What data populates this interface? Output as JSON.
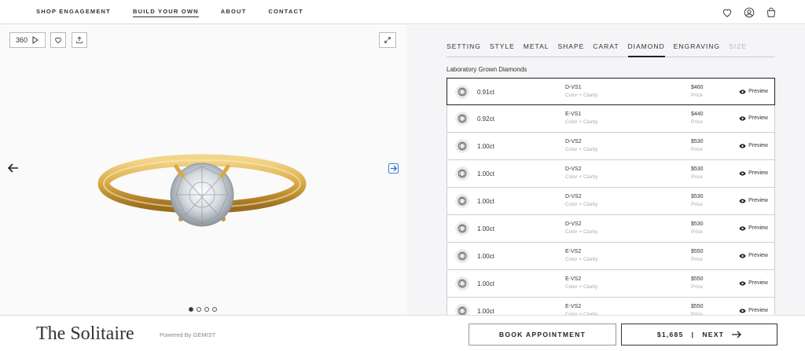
{
  "nav": {
    "links": [
      {
        "label": "SHOP ENGAGEMENT"
      },
      {
        "label": "BUILD YOUR OWN"
      },
      {
        "label": "ABOUT"
      },
      {
        "label": "CONTACT"
      }
    ],
    "active_index": 1,
    "icons": [
      "heart-icon",
      "account-icon",
      "bag-icon"
    ]
  },
  "viewer": {
    "btn_360_label": "360",
    "image_count": 4,
    "active_image": 1
  },
  "tabs": [
    {
      "label": "SETTING"
    },
    {
      "label": "STYLE"
    },
    {
      "label": "METAL"
    },
    {
      "label": "SHAPE"
    },
    {
      "label": "CARAT"
    },
    {
      "label": "DIAMOND"
    },
    {
      "label": "ENGRAVING"
    },
    {
      "label": "SIZE"
    }
  ],
  "active_tab": 5,
  "disabled_tab": 7,
  "section_title": "Laboratory Grown Diamonds",
  "grade_sublabel": "Color + Clarity",
  "price_sublabel": "Price",
  "preview_label": "Preview",
  "diamonds": [
    {
      "carat": "0.91ct",
      "grade": "D-VS1",
      "price": "$460",
      "selected": true
    },
    {
      "carat": "0.92ct",
      "grade": "E-VS1",
      "price": "$440",
      "selected": false
    },
    {
      "carat": "1.00ct",
      "grade": "D-VS2",
      "price": "$530",
      "selected": false
    },
    {
      "carat": "1.00ct",
      "grade": "D-VS2",
      "price": "$530",
      "selected": false
    },
    {
      "carat": "1.00ct",
      "grade": "D-VS2",
      "price": "$530",
      "selected": false
    },
    {
      "carat": "1.00ct",
      "grade": "D-VS2",
      "price": "$530",
      "selected": false
    },
    {
      "carat": "1.00ct",
      "grade": "E-VS2",
      "price": "$550",
      "selected": false
    },
    {
      "carat": "1.00ct",
      "grade": "E-VS2",
      "price": "$550",
      "selected": false
    },
    {
      "carat": "1.00ct",
      "grade": "E-VS2",
      "price": "$550",
      "selected": false
    }
  ],
  "footer": {
    "product_name": "The Solitaire",
    "powered_by": "Powered By GEMIST",
    "book_label": "BOOK APPOINTMENT",
    "total_price": "$1,685",
    "divider": "|",
    "next_label": "NEXT"
  }
}
